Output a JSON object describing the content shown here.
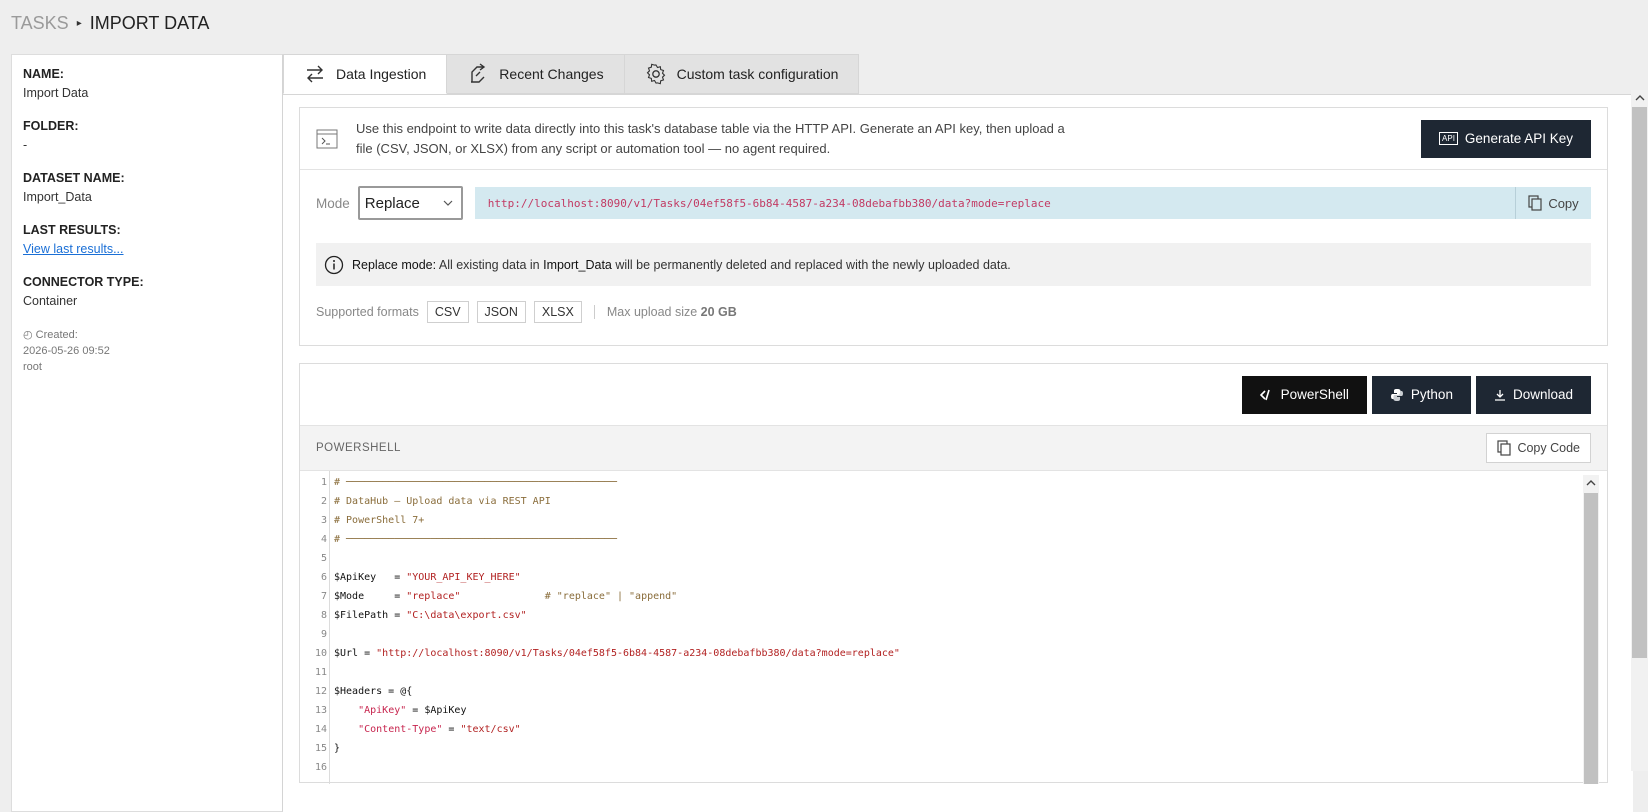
{
  "breadcrumb": {
    "root": "TASKS",
    "separator": "▸",
    "current": "IMPORT DATA"
  },
  "sidebar": {
    "name_label": "NAME:",
    "name_value": "Import Data",
    "folder_label": "FOLDER:",
    "folder_value": "-",
    "dataset_label": "DATASET NAME:",
    "dataset_value": "Import_Data",
    "last_results_label": "LAST RESULTS:",
    "last_results_link": "View last results...",
    "connector_label": "CONNECTOR TYPE:",
    "connector_value": "Container",
    "created_label": "◴ Created:",
    "created_date": "2026-05-26 09:52",
    "created_by": "root"
  },
  "tabs": [
    {
      "label": "Data Ingestion",
      "icon": "transfer-icon",
      "active": true
    },
    {
      "label": "Recent Changes",
      "icon": "history-icon",
      "active": false
    },
    {
      "label": "Custom task configuration",
      "icon": "gear-icon",
      "active": false
    }
  ],
  "ingestion": {
    "description": "Use this endpoint to write data directly into this task's database table via the HTTP API. Generate an API key, then upload a file (CSV, JSON, or XLSX) from any script or automation tool — no agent required.",
    "generate_label": "Generate API Key",
    "api_badge": "API",
    "mode_label": "Mode",
    "mode_value": "Replace",
    "url": "http://localhost:8090/v1/Tasks/04ef58f5-6b84-4587-a234-08debafbb380/data?mode=replace",
    "copy_label": "Copy",
    "info_prefix": "Replace mode:",
    "info_mid1": " All existing data in ",
    "info_dataset": "Import_Data",
    "info_mid2": " will be permanently deleted and replaced with the newly uploaded data.",
    "formats_label": "Supported formats",
    "formats": [
      "CSV",
      "JSON",
      "XLSX"
    ],
    "max_label": "Max upload size",
    "max_value": "20 GB"
  },
  "snippet": {
    "buttons": {
      "powershell": "PowerShell",
      "python": "Python",
      "download": "Download"
    },
    "title": "POWERSHELL",
    "copy_code": "Copy Code",
    "line_numbers": [
      "1",
      "2",
      "3",
      "4",
      "5",
      "6",
      "7",
      "8",
      "9",
      "10",
      "11",
      "12",
      "13",
      "14",
      "15",
      "16"
    ]
  },
  "colors": {
    "dark_button": "#1e2733",
    "url_bg": "#d4e9f0",
    "link": "#1a6fd6"
  }
}
